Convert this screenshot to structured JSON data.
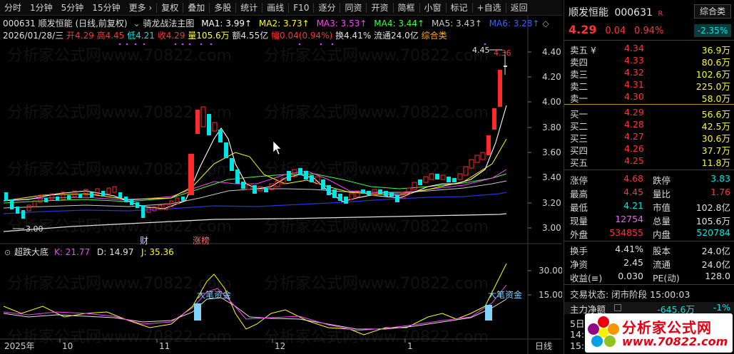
{
  "toolbar": {
    "items": [
      "分时",
      "1分钟",
      "5分钟",
      "15分钟",
      "更多 ›"
    ],
    "tools": [
      "复权",
      "叠加",
      "多股",
      "统计",
      "画线",
      "F10",
      "逐分",
      "同资",
      "开资",
      "简框",
      "小窗",
      "标记",
      "+自选",
      "返回"
    ]
  },
  "header": {
    "stock_line": "000631 顺发恒能 (日线,前复权)",
    "indicator_name": "骑龙战法主图",
    "ma": [
      {
        "label": "MA1:",
        "value": "3.99↑"
      },
      {
        "label": "MA2:",
        "value": "3.73↑"
      },
      {
        "label": "MA3:",
        "value": "3.53↑"
      },
      {
        "label": "MA4:",
        "value": "3.44↑"
      },
      {
        "label": "MA5:",
        "value": "3.43↑"
      },
      {
        "label": "MA6:",
        "value": "3.28↑"
      }
    ],
    "date": "2026/01/28/三",
    "open": "开4.29",
    "high": "高4.45",
    "low": "低4.21",
    "close": "收4.29",
    "volume": "量105.6万",
    "amount": "额4.55亿",
    "amplitude": "幅0.04(0.94%)",
    "turnover": "换4.41%",
    "float_cap": "流通24.0亿",
    "category": "综合类"
  },
  "main_chart": {
    "y_ticks": [
      "4.40",
      "4.20",
      "4.00",
      "3.80",
      "3.60",
      "3.40",
      "3.20",
      "3.00"
    ],
    "high_mark": "4.45",
    "high_mark_red": "4.36",
    "low_mark": "3.00",
    "marker_cai": "财",
    "marker_zhang": "涨榜",
    "colors": {
      "up": "#ff2a2a",
      "down": "#00e5e5",
      "ma1": "#ffffff",
      "ma2": "#ffff00",
      "ma3": "#ff40ff",
      "ma4": "#40ff40",
      "ma5": "#c8c8c8",
      "ma6": "#3366ff"
    }
  },
  "sub_chart": {
    "name": "超跌大底",
    "k": "K: 21.77",
    "d": "D: 14.97",
    "j": "J: 35.36",
    "y_ticks": [
      "30.00",
      "15.00"
    ],
    "signal_label_1": "大笔资金",
    "signal_label_2": "大笔资金"
  },
  "x_axis": {
    "labels": [
      "2025年",
      "10",
      "11",
      "12",
      "1"
    ],
    "right_label": "日线"
  },
  "panel": {
    "title": "顺发恒能",
    "code": "000631",
    "r_badge": "R",
    "category_btn": "综合类",
    "price": "4.29",
    "change": "0.04",
    "change_pct": "0.94%",
    "category_pct": "-2.35%",
    "asks": [
      {
        "label": "卖五 ¥",
        "price": "4.34",
        "vol": "36.9万"
      },
      {
        "label": "卖四",
        "price": "4.33",
        "vol": "80.6万"
      },
      {
        "label": "卖三",
        "price": "4.32",
        "vol": "102.6万"
      },
      {
        "label": "卖二",
        "price": "4.31",
        "vol": "225.0万"
      },
      {
        "label": "卖一",
        "price": "4.30",
        "vol": "58.0万"
      }
    ],
    "bids": [
      {
        "label": "买一",
        "price": "4.29",
        "vol": "56.6万"
      },
      {
        "label": "买二",
        "price": "4.28",
        "vol": "42.5万"
      },
      {
        "label": "买三",
        "price": "4.27",
        "vol": "30.6万"
      },
      {
        "label": "买四",
        "price": "4.26",
        "vol": "37.7万"
      },
      {
        "label": "买五",
        "price": "4.25",
        "vol": "11.8万"
      }
    ],
    "stats1": [
      {
        "l1": "涨停",
        "v1": "4.68",
        "l2": "跌停",
        "v2": "3.83"
      },
      {
        "l1": "最高",
        "v1": "4.45",
        "l2": "量比",
        "v2": "1.76"
      },
      {
        "l1": "最低",
        "v1": "4.21",
        "l2": "市值",
        "v2": "102.8亿"
      },
      {
        "l1": "现量",
        "v1": "12754",
        "l2": "总量",
        "v2": "105.6万"
      },
      {
        "l1": "外盘",
        "v1": "534855",
        "l2": "内盘",
        "v2": "520784"
      }
    ],
    "stats2": [
      {
        "l1": "换手",
        "v1": "4.41%",
        "l2": "股本",
        "v2": "24.0亿"
      },
      {
        "l1": "净资",
        "v1": "2.45",
        "l2": "流通",
        "v2": "24.0亿"
      },
      {
        "l1": "收益(≡)",
        "v1": "0.030",
        "l2": "PE(动)",
        "v2": "128.0"
      }
    ],
    "trade_status": "交易状态: 闭市阶段 15:00:03",
    "capital_label": "主力净额",
    "capital_value": "-645.6万",
    "capital_pct": "-1%",
    "day_label": "5日",
    "t1": "14:",
    "t2": "15:"
  },
  "logo": {
    "text": "分析家公式网",
    "url": "www.70822.com"
  },
  "watermark": "分析家公式网www.70822.com"
}
